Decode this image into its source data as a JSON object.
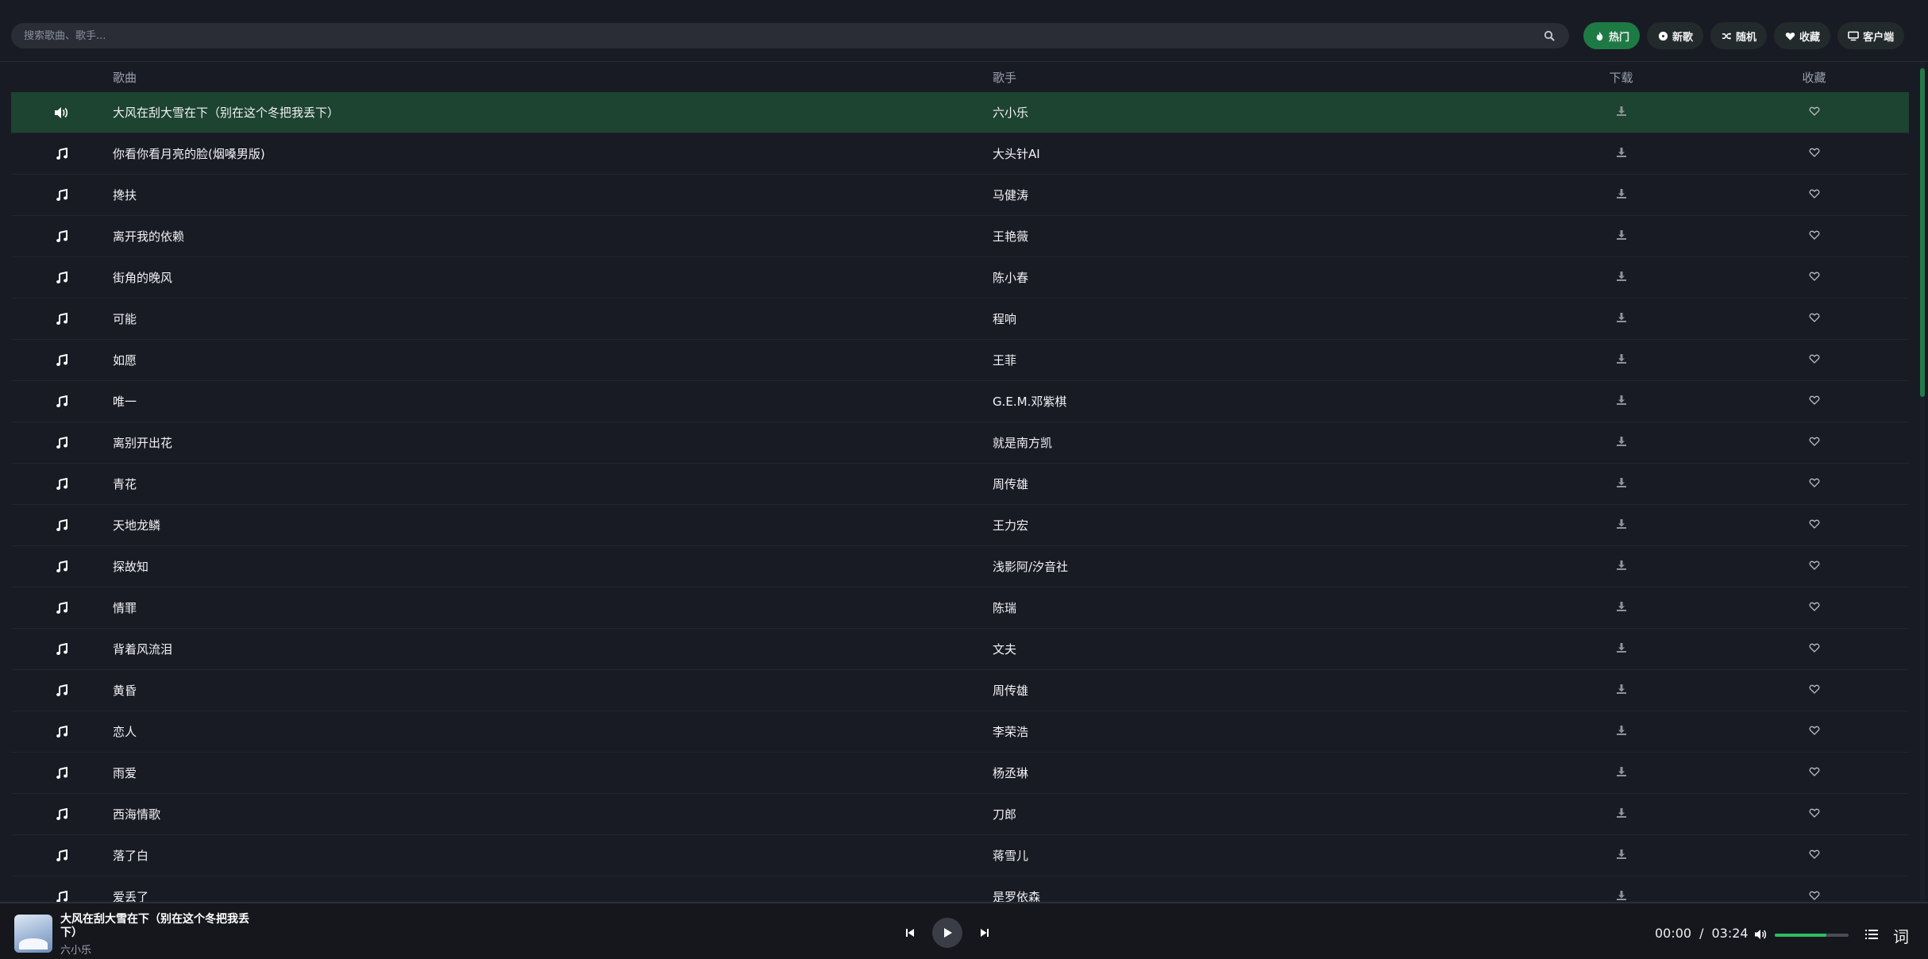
{
  "search": {
    "placeholder": "搜索歌曲、歌手..."
  },
  "nav": [
    {
      "label": "热门",
      "icon": "fire-icon",
      "active": true
    },
    {
      "label": "新歌",
      "icon": "disc-icon",
      "active": false
    },
    {
      "label": "随机",
      "icon": "shuffle-icon",
      "active": false
    },
    {
      "label": "收藏",
      "icon": "heart-icon",
      "active": false
    },
    {
      "label": "客户端",
      "icon": "monitor-icon",
      "active": false
    }
  ],
  "table": {
    "headers": {
      "song": "歌曲",
      "artist": "歌手",
      "download": "下载",
      "favorite": "收藏"
    },
    "rows": [
      {
        "title": "大风在刮大雪在下（别在这个冬把我丢下）",
        "artist": "六小乐",
        "playing": true
      },
      {
        "title": "你看你看月亮的脸(烟嗓男版)",
        "artist": "大头针AI",
        "playing": false
      },
      {
        "title": "搀扶",
        "artist": "马健涛",
        "playing": false
      },
      {
        "title": "离开我的依赖",
        "artist": "王艳薇",
        "playing": false
      },
      {
        "title": "街角的晚风",
        "artist": "陈小春",
        "playing": false
      },
      {
        "title": "可能",
        "artist": "程响",
        "playing": false
      },
      {
        "title": "如愿",
        "artist": "王菲",
        "playing": false
      },
      {
        "title": "唯一",
        "artist": "G.E.M.邓紫棋",
        "playing": false
      },
      {
        "title": "离别开出花",
        "artist": "就是南方凯",
        "playing": false
      },
      {
        "title": "青花",
        "artist": "周传雄",
        "playing": false
      },
      {
        "title": "天地龙鳞",
        "artist": "王力宏",
        "playing": false
      },
      {
        "title": "探故知",
        "artist": "浅影阿/汐音社",
        "playing": false
      },
      {
        "title": "情罪",
        "artist": "陈瑞",
        "playing": false
      },
      {
        "title": "背着风流泪",
        "artist": "文夫",
        "playing": false
      },
      {
        "title": "黄昏",
        "artist": "周传雄",
        "playing": false
      },
      {
        "title": "恋人",
        "artist": "李荣浩",
        "playing": false
      },
      {
        "title": "雨爱",
        "artist": "杨丞琳",
        "playing": false
      },
      {
        "title": "西海情歌",
        "artist": "刀郎",
        "playing": false
      },
      {
        "title": "落了白",
        "artist": "蒋雪儿",
        "playing": false
      },
      {
        "title": "爱丢了",
        "artist": "是罗依森",
        "playing": false
      }
    ]
  },
  "player": {
    "title": "大风在刮大雪在下（别在这个冬把我丢下）",
    "artist": "六小乐",
    "current_time": "00:00",
    "separator": "/",
    "duration": "03:24",
    "volume": 0.7,
    "lyric_label": "词"
  },
  "colors": {
    "accent": "#1e7a45",
    "playing_row": "#1d4331",
    "volume": "#2dbd62"
  }
}
